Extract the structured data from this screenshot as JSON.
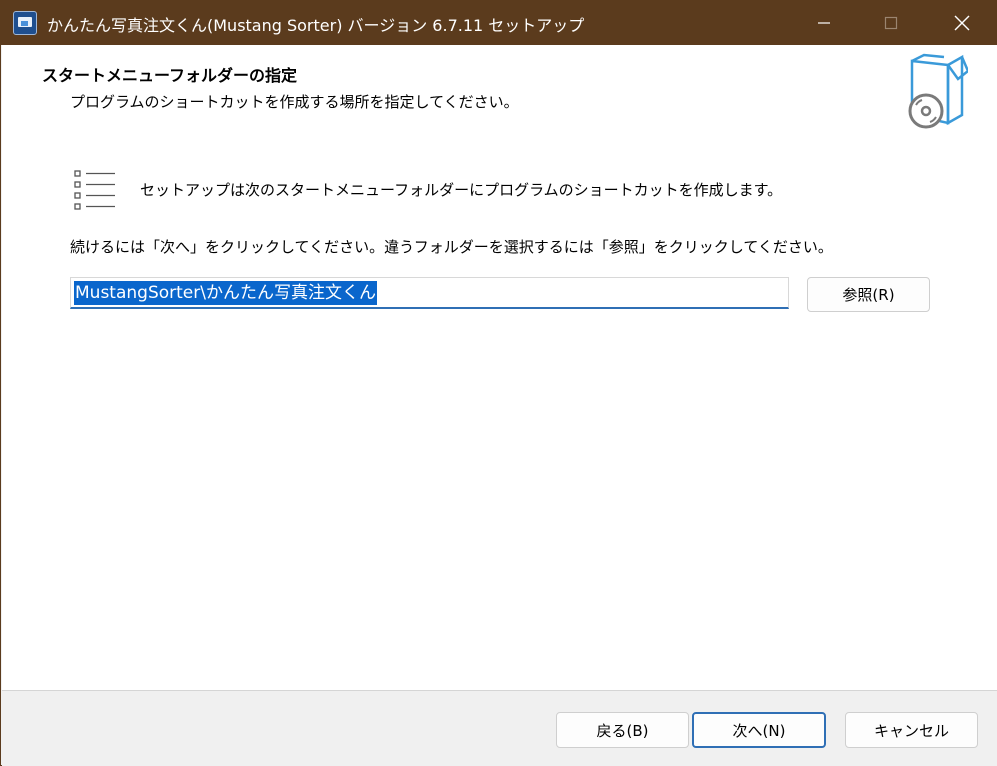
{
  "window": {
    "title": "かんたん写真注文くん(Mustang Sorter) バージョン 6.7.11 セットアップ",
    "minimize_glyph": "—",
    "maximize_glyph": "☐",
    "close_glyph": "✕"
  },
  "header": {
    "heading": "スタートメニューフォルダーの指定",
    "subheading": "プログラムのショートカットを作成する場所を指定してください。",
    "icon": "setup-box-cd-icon"
  },
  "main": {
    "list_icon": "list-icon",
    "info_text": "セットアップは次のスタートメニューフォルダーにプログラムのショートカットを作成します。",
    "instruction": "続けるには「次へ」をクリックしてください。違うフォルダーを選択するには「参照」をクリックしてください。",
    "folder_value": "MustangSorter\\かんたん写真注文くん",
    "browse_label": "参照(R)"
  },
  "footer": {
    "back_label": "戻る(B)",
    "next_label": "次へ(N)",
    "cancel_label": "キャンセル"
  },
  "colors": {
    "titlebar": "#5b3b1d",
    "accent": "#2f6fb5",
    "selection": "#0a66cc",
    "box_icon_blue": "#3a9ad9"
  }
}
